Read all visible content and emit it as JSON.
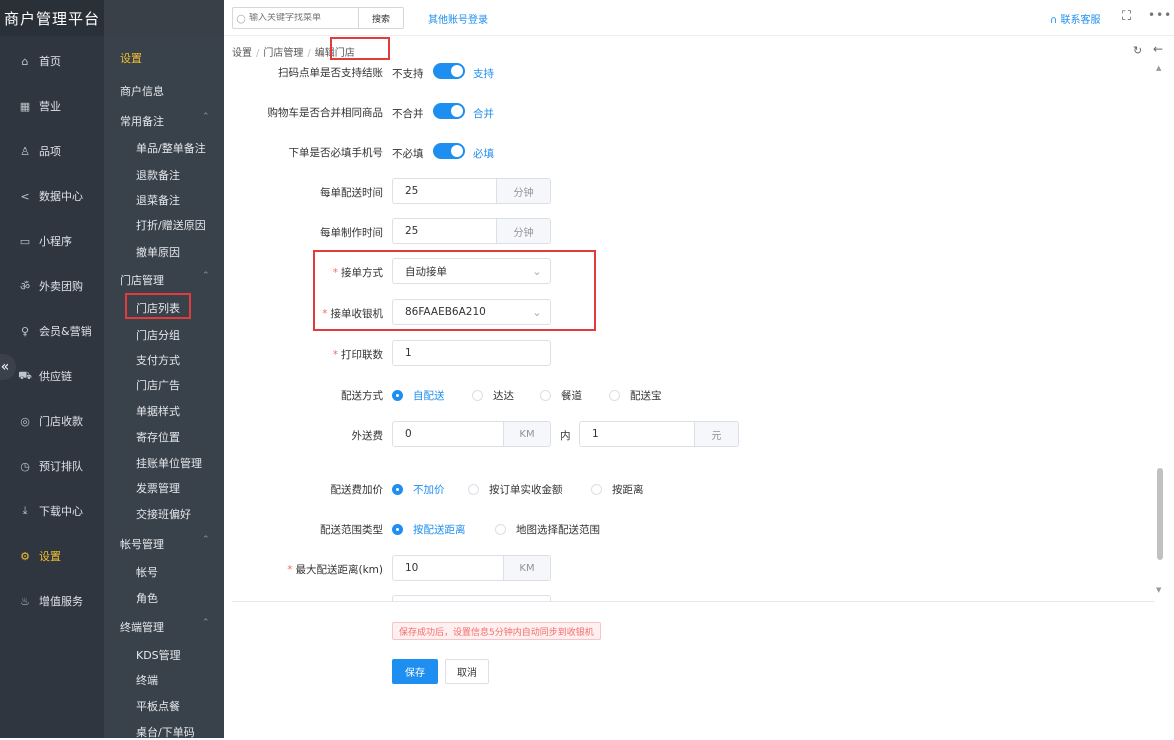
{
  "app": {
    "title": "商户管理平台"
  },
  "nav": [
    {
      "label": "首页",
      "icon": "home-icon"
    },
    {
      "label": "营业",
      "icon": "calendar-icon"
    },
    {
      "label": "品项",
      "icon": "bag-icon"
    },
    {
      "label": "数据中心",
      "icon": "share-icon"
    },
    {
      "label": "小程序",
      "icon": "tablet-icon"
    },
    {
      "label": "外卖团购",
      "icon": "bike-icon"
    },
    {
      "label": "会员&营销",
      "icon": "user-icon"
    },
    {
      "label": "供应链",
      "icon": "truck-icon"
    },
    {
      "label": "门店收款",
      "icon": "database-icon"
    },
    {
      "label": "预订排队",
      "icon": "clock-icon"
    },
    {
      "label": "下载中心",
      "icon": "download-icon"
    },
    {
      "label": "设置",
      "icon": "gear-icon"
    },
    {
      "label": "增值服务",
      "icon": "bell-icon"
    }
  ],
  "subnav": {
    "title": "设置",
    "items": [
      {
        "label": "商户信息",
        "type": "sec"
      },
      {
        "label": "常用备注",
        "type": "sec"
      },
      {
        "label": "单品/整单备注",
        "type": "item"
      },
      {
        "label": "退款备注",
        "type": "item"
      },
      {
        "label": "退菜备注",
        "type": "item"
      },
      {
        "label": "打折/赠送原因",
        "type": "item"
      },
      {
        "label": "撤单原因",
        "type": "item"
      },
      {
        "label": "门店管理",
        "type": "sec"
      },
      {
        "label": "门店列表",
        "type": "item"
      },
      {
        "label": "门店分组",
        "type": "item"
      },
      {
        "label": "支付方式",
        "type": "item"
      },
      {
        "label": "门店广告",
        "type": "item"
      },
      {
        "label": "单据样式",
        "type": "item"
      },
      {
        "label": "寄存位置",
        "type": "item"
      },
      {
        "label": "挂账单位管理",
        "type": "item"
      },
      {
        "label": "发票管理",
        "type": "item"
      },
      {
        "label": "交接班偏好",
        "type": "item"
      },
      {
        "label": "帐号管理",
        "type": "sec"
      },
      {
        "label": "帐号",
        "type": "item"
      },
      {
        "label": "角色",
        "type": "item"
      },
      {
        "label": "终端管理",
        "type": "sec"
      },
      {
        "label": "KDS管理",
        "type": "item"
      },
      {
        "label": "终端",
        "type": "item"
      },
      {
        "label": "平板点餐",
        "type": "item"
      },
      {
        "label": "桌台/下单码",
        "type": "item"
      }
    ]
  },
  "topbar": {
    "search_placeholder": "输入关键字找菜单",
    "search_button": "搜索",
    "other_login": "其他账号登录",
    "service": "联系客服"
  },
  "breadcrumb": [
    "设置",
    "门店管理",
    "编辑门店"
  ],
  "form": {
    "scan_checkout": {
      "label": "扫码点单是否支持结账",
      "off": "不支持",
      "on": "支持"
    },
    "cart_merge": {
      "label": "购物车是否合并相同商品",
      "off": "不合并",
      "on": "合并"
    },
    "phone_required": {
      "label": "下单是否必填手机号",
      "off": "不必填",
      "on": "必填"
    },
    "delivery_time": {
      "label": "每单配送时间",
      "value": "25",
      "unit": "分钟"
    },
    "make_time": {
      "label": "每单制作时间",
      "value": "25",
      "unit": "分钟"
    },
    "accept_mode": {
      "label": "接单方式",
      "value": "自动接单"
    },
    "accept_cashier": {
      "label": "接单收银机",
      "value": "86FAAEB6A210"
    },
    "print_copies": {
      "label": "打印联数",
      "value": "1"
    },
    "delivery_method": {
      "label": "配送方式",
      "options": [
        "自配送",
        "达达",
        "餐道",
        "配送宝"
      ]
    },
    "delivery_fee": {
      "label": "外送费",
      "distance": "0",
      "distance_unit": "KM",
      "within": "内",
      "fee": "1",
      "fee_unit": "元"
    },
    "fee_markup": {
      "label": "配送费加价",
      "options": [
        "不加价",
        "按订单实收金额",
        "按距离"
      ]
    },
    "range_type": {
      "label": "配送范围类型",
      "options": [
        "按配送距离",
        "地图选择配送范围"
      ]
    },
    "max_distance": {
      "label": "最大配送距离(km)",
      "value": "10",
      "unit": "KM"
    }
  },
  "footer": {
    "notice": "保存成功后，设置信息5分钟内自动同步到收银机",
    "save": "保存",
    "cancel": "取消"
  },
  "colors": {
    "accent": "#1e8ef0",
    "highlight": "#e23b3b",
    "active_nav": "#f0c030"
  }
}
